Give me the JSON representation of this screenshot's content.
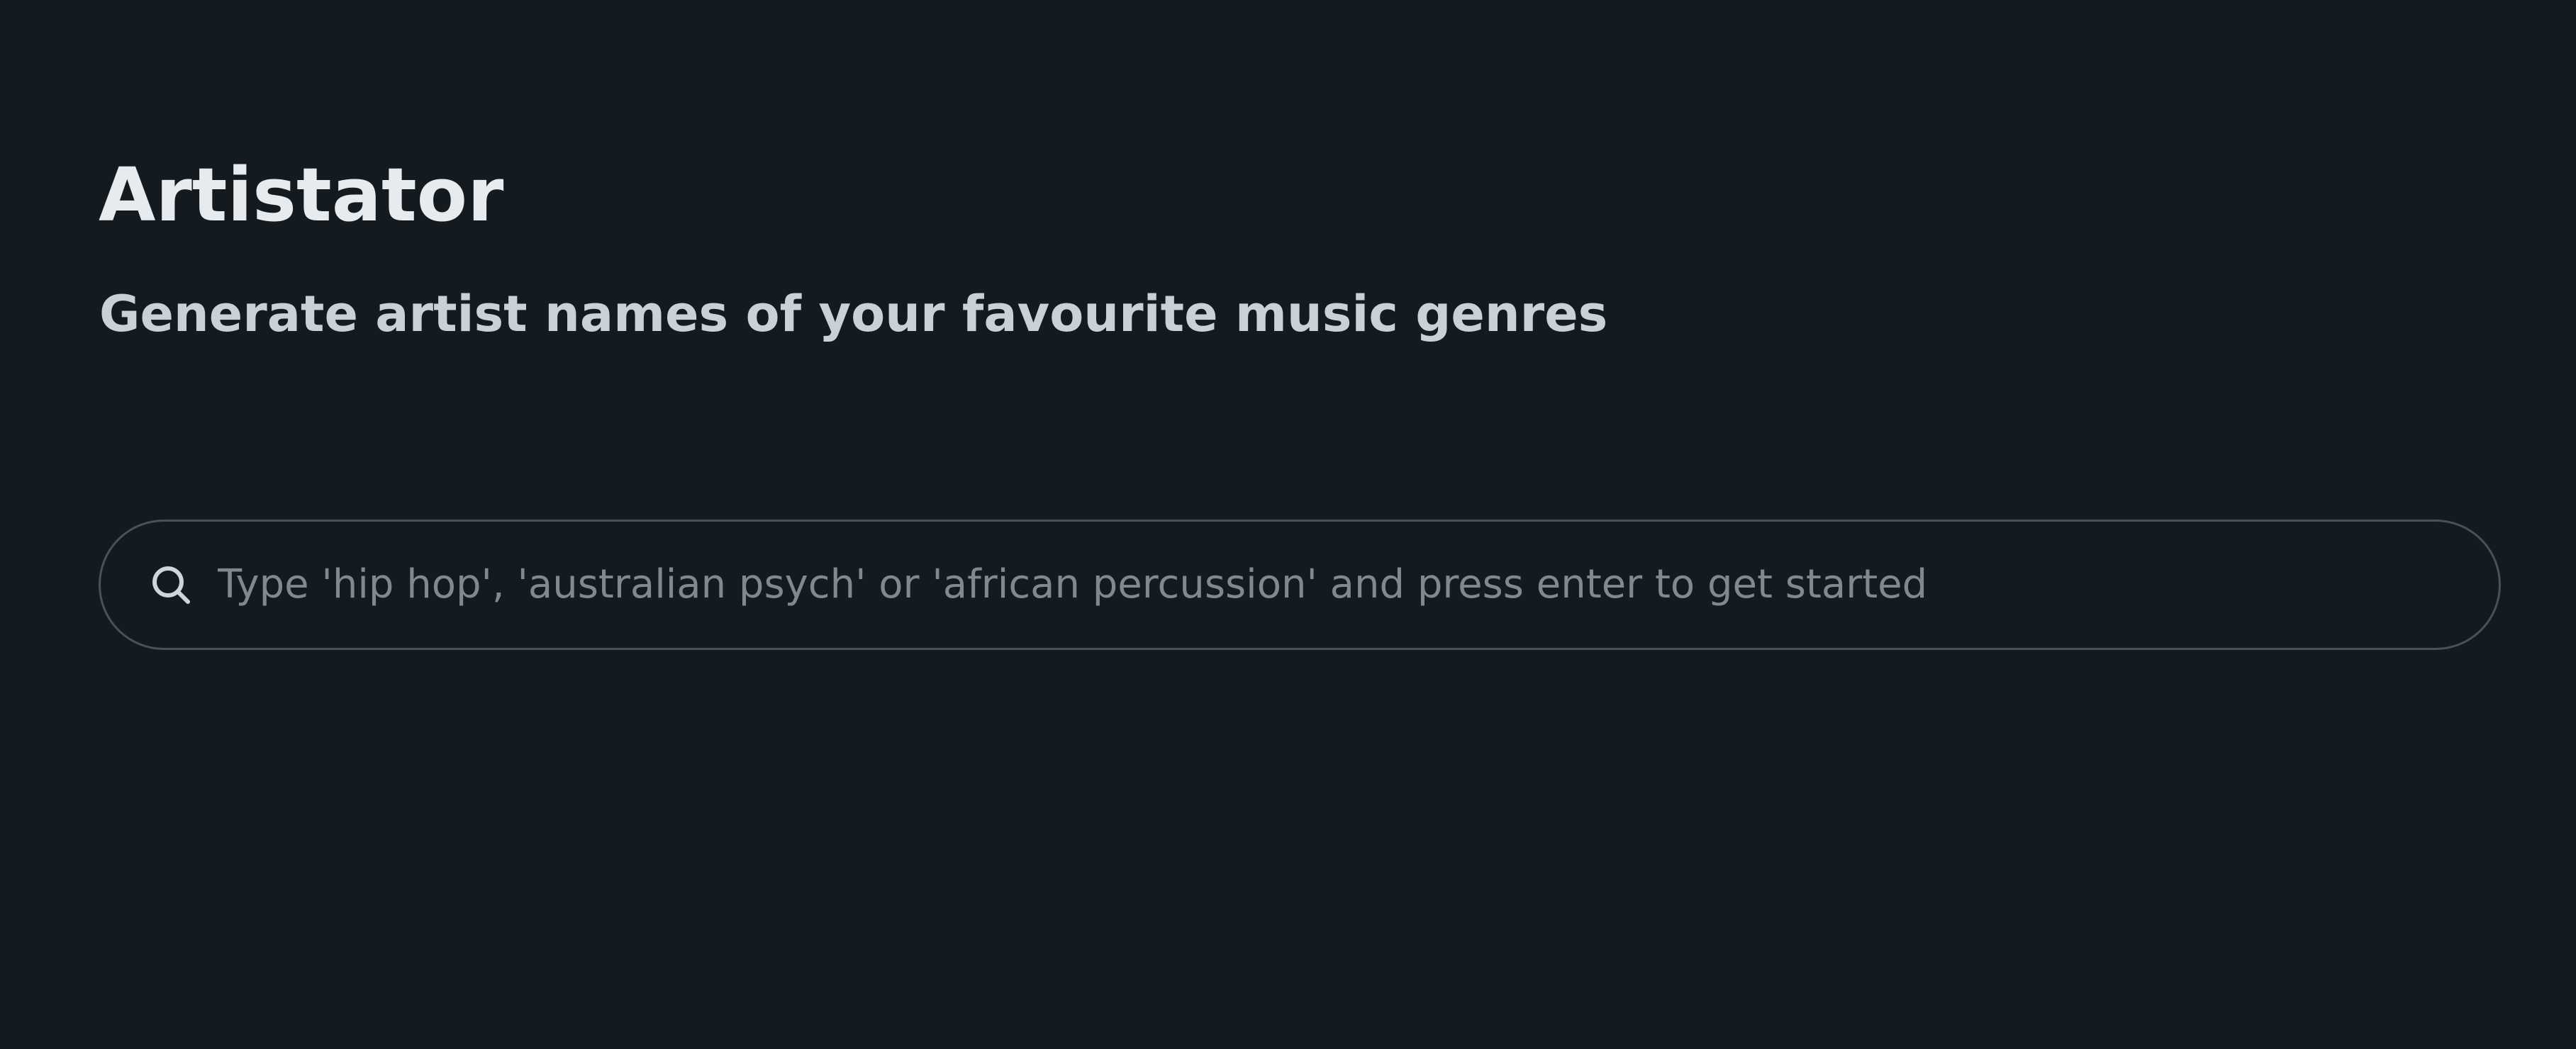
{
  "app": {
    "title": "Artistator",
    "subtitle": "Generate artist names of your favourite music genres"
  },
  "search": {
    "value": "",
    "placeholder": "Type 'hip hop', 'australian psych' or 'african percussion' and press enter to get started",
    "icon": "search-icon"
  },
  "colors": {
    "background": "#131a20",
    "title": "#e8ebee",
    "subtitle": "#c9d0d6",
    "search_border": "#46525c",
    "placeholder": "#7f8991"
  }
}
